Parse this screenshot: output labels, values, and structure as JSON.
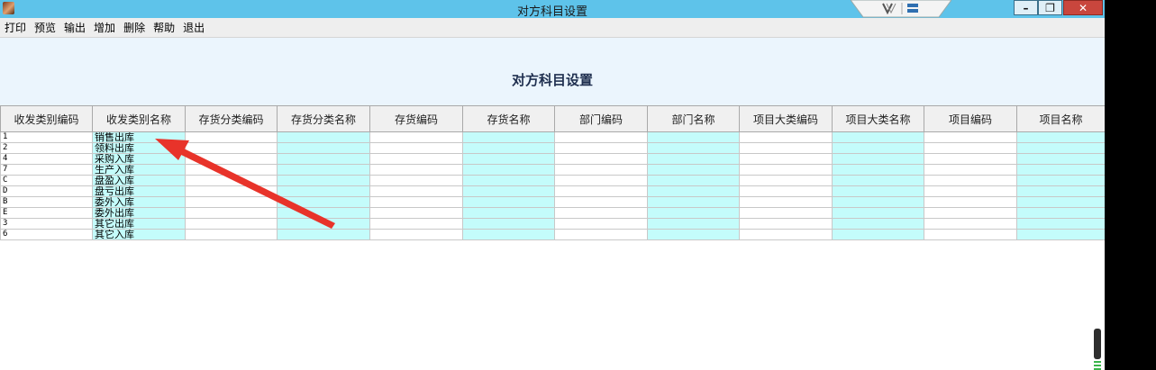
{
  "window": {
    "title": "对方科目设置",
    "controls": {
      "minimize": "–",
      "maximize": "❐",
      "close": "✕"
    }
  },
  "menu": {
    "items": [
      "打印",
      "预览",
      "输出",
      "增加",
      "删除",
      "帮助",
      "退出"
    ]
  },
  "report": {
    "title": "对方科目设置"
  },
  "table": {
    "columns": [
      {
        "label": "收发类别编码",
        "highlight": false
      },
      {
        "label": "收发类别名称",
        "highlight": true
      },
      {
        "label": "存货分类编码",
        "highlight": false
      },
      {
        "label": "存货分类名称",
        "highlight": true
      },
      {
        "label": "存货编码",
        "highlight": false
      },
      {
        "label": "存货名称",
        "highlight": true
      },
      {
        "label": "部门编码",
        "highlight": false
      },
      {
        "label": "部门名称",
        "highlight": true
      },
      {
        "label": "项目大类编码",
        "highlight": false
      },
      {
        "label": "项目大类名称",
        "highlight": true
      },
      {
        "label": "项目编码",
        "highlight": false
      },
      {
        "label": "项目名称",
        "highlight": true
      }
    ],
    "rows": [
      {
        "code": "1",
        "name": "销售出库"
      },
      {
        "code": "2",
        "name": "领料出库"
      },
      {
        "code": "4",
        "name": "采购入库"
      },
      {
        "code": "7",
        "name": "生产入库"
      },
      {
        "code": "C",
        "name": "盘盈入库"
      },
      {
        "code": "D",
        "name": "盘亏出库"
      },
      {
        "code": "B",
        "name": "委外入库"
      },
      {
        "code": "E",
        "name": "委外出库"
      },
      {
        "code": "3",
        "name": "其它出库"
      },
      {
        "code": "6",
        "name": "其它入库"
      }
    ]
  },
  "colors": {
    "titlebar": "#5ec3ea",
    "header_bg": "#ebf5fd",
    "highlight_column": "#c4fcfb",
    "annotation_arrow": "#e8332a",
    "close_button": "#c9463d"
  },
  "icons": [
    "app-icon",
    "logo-badge-icon",
    "minimize-icon",
    "maximize-icon",
    "close-icon",
    "red-arrow-annotation"
  ]
}
